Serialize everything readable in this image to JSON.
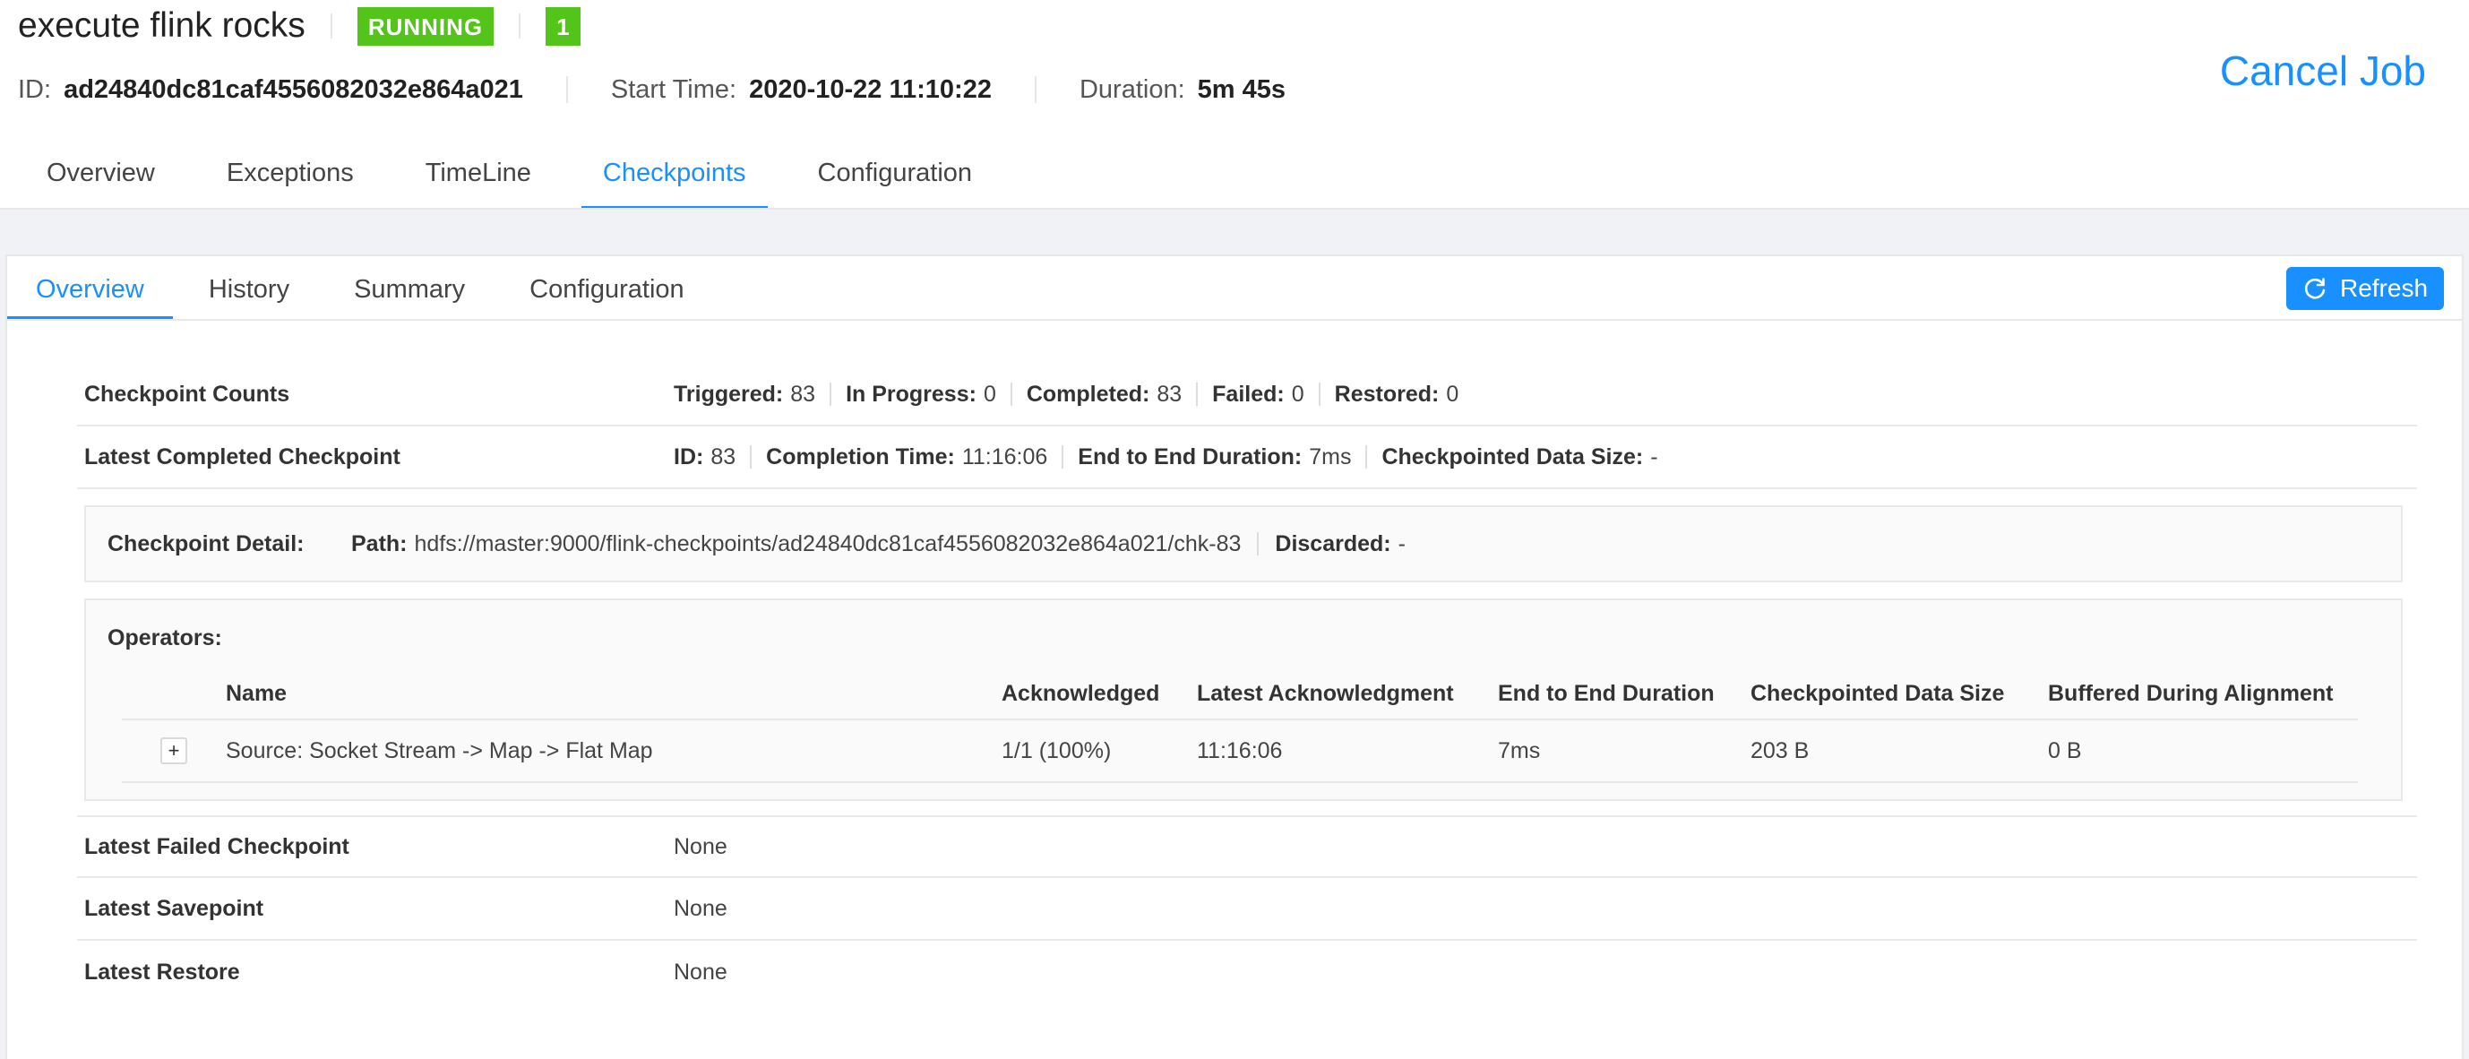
{
  "job": {
    "title": "execute flink rocks",
    "status": "RUNNING",
    "task_count": "1",
    "id_label": "ID:",
    "id_value": "ad24840dc81caf4556082032e864a021",
    "start_label": "Start Time:",
    "start_value": "2020-10-22 11:10:22",
    "duration_label": "Duration:",
    "duration_value": "5m 45s",
    "cancel_label": "Cancel Job"
  },
  "main_tabs": [
    {
      "label": "Overview",
      "active": false
    },
    {
      "label": "Exceptions",
      "active": false
    },
    {
      "label": "TimeLine",
      "active": false
    },
    {
      "label": "Checkpoints",
      "active": true
    },
    {
      "label": "Configuration",
      "active": false
    }
  ],
  "sub_tabs": [
    {
      "label": "Overview",
      "active": true
    },
    {
      "label": "History",
      "active": false
    },
    {
      "label": "Summary",
      "active": false
    },
    {
      "label": "Configuration",
      "active": false
    }
  ],
  "refresh_label": "Refresh",
  "counts": {
    "label": "Checkpoint Counts",
    "triggered_k": "Triggered:",
    "triggered_v": "83",
    "in_progress_k": "In Progress:",
    "in_progress_v": "0",
    "completed_k": "Completed:",
    "completed_v": "83",
    "failed_k": "Failed:",
    "failed_v": "0",
    "restored_k": "Restored:",
    "restored_v": "0"
  },
  "latest_completed": {
    "label": "Latest Completed Checkpoint",
    "id_k": "ID:",
    "id_v": "83",
    "completion_k": "Completion Time:",
    "completion_v": "11:16:06",
    "e2e_k": "End to End Duration:",
    "e2e_v": "7ms",
    "size_k": "Checkpointed Data Size:",
    "size_v": "-"
  },
  "detail": {
    "label": "Checkpoint Detail:",
    "path_k": "Path:",
    "path_v": "hdfs://master:9000/flink-checkpoints/ad24840dc81caf4556082032e864a021/chk-83",
    "discarded_k": "Discarded:",
    "discarded_v": "-"
  },
  "operators": {
    "title": "Operators:",
    "columns": [
      "Name",
      "Acknowledged",
      "Latest Acknowledgment",
      "End to End Duration",
      "Checkpointed Data Size",
      "Buffered During Alignment"
    ],
    "rows": [
      {
        "expand": "+",
        "name": "Source: Socket Stream -> Map -> Flat Map",
        "acknowledged": "1/1 (100%)",
        "latest_ack": "11:16:06",
        "e2e": "7ms",
        "size": "203 B",
        "buffered": "0 B"
      }
    ]
  },
  "latest_failed": {
    "label": "Latest Failed Checkpoint",
    "value": "None"
  },
  "latest_savepoint": {
    "label": "Latest Savepoint",
    "value": "None"
  },
  "latest_restore": {
    "label": "Latest Restore",
    "value": "None"
  },
  "colors": {
    "accent": "#1890ff",
    "status_green": "#52c41a",
    "background": "#f0f2f5"
  },
  "icons": {
    "refresh": "refresh-icon"
  }
}
